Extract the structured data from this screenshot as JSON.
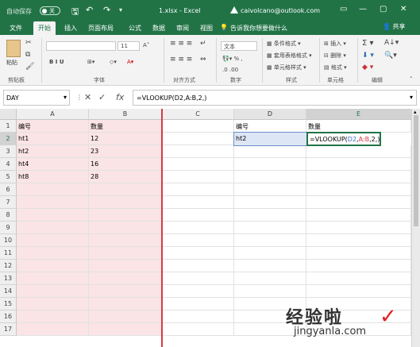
{
  "titlebar": {
    "autosave": "自动保存",
    "autosave_state": "关",
    "filename": "1.xlsx - Excel",
    "user": "caivolcano@outlook.com"
  },
  "tabs": [
    "文件",
    "开始",
    "插入",
    "页面布局",
    "公式",
    "数据",
    "审阅",
    "视图"
  ],
  "active_tab_index": 1,
  "tellme": "告诉我你想要做什么",
  "share": "共享",
  "ribbon": {
    "paste": "粘贴",
    "groups": [
      "剪贴板",
      "字体",
      "对齐方式",
      "数字",
      "样式",
      "单元格",
      "编辑"
    ],
    "font_size": "11",
    "number_format": "文本",
    "style_items": [
      "条件格式",
      "套用表格格式",
      "单元格样式"
    ],
    "cell_items": [
      "插入",
      "删除",
      "格式"
    ],
    "font_buttons": "B  I  U"
  },
  "formula_bar": {
    "name_box": "DAY",
    "formula": "=VLOOKUP(D2,A:B,2,)"
  },
  "columns": [
    "A",
    "B",
    "C",
    "D",
    "E"
  ],
  "rows": [
    "1",
    "2",
    "3",
    "4",
    "5",
    "6",
    "7",
    "8",
    "9",
    "10",
    "11",
    "12",
    "13",
    "14",
    "15",
    "16",
    "17"
  ],
  "cells": {
    "A1": "编号",
    "B1": "数量",
    "A2": "ht1",
    "B2": "12",
    "A3": "ht2",
    "B3": "23",
    "A4": "ht4",
    "B4": "16",
    "A5": "ht8",
    "B5": "28",
    "D1": "编号",
    "E1": "数量",
    "D2": "ht2",
    "E2_parts": [
      "=VLOOKUP(",
      "D2",
      ",",
      "A:B",
      ",2,)"
    ]
  },
  "colors": {
    "accent": "#217346",
    "highlight_pink": "#fbe4e6",
    "ref_blue": "#3d6cc0",
    "ref_red": "#d83a44"
  },
  "watermark": {
    "text": "经验啦",
    "url": "jingyanla.com"
  }
}
